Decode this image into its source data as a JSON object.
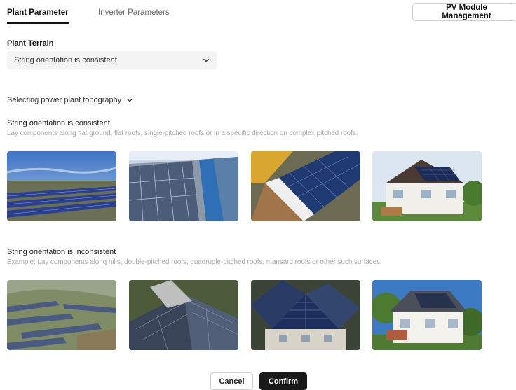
{
  "tabs": {
    "plant_parameter": "Plant Parameter",
    "inverter_parameters": "Inverter Parameters"
  },
  "pv_module_button": "PV Module Management",
  "plant_terrain": {
    "label": "Plant Terrain",
    "selected": "String orientation is consistent"
  },
  "topography_toggle": "Selecting power plant topography",
  "consistent": {
    "title": "String orientation is consistent",
    "description": "Lay components along flat ground, flat roofs, single-pitched roofs or in a specific direction on complex pitched roofs."
  },
  "inconsistent": {
    "title": "String orientation is inconsistent",
    "description": "Example: Lay components along hills, double-pitched roofs, quadruple-pitched roofs, mansard roofs or other such surfaces."
  },
  "buttons": {
    "cancel": "Cancel",
    "confirm": "Confirm"
  }
}
